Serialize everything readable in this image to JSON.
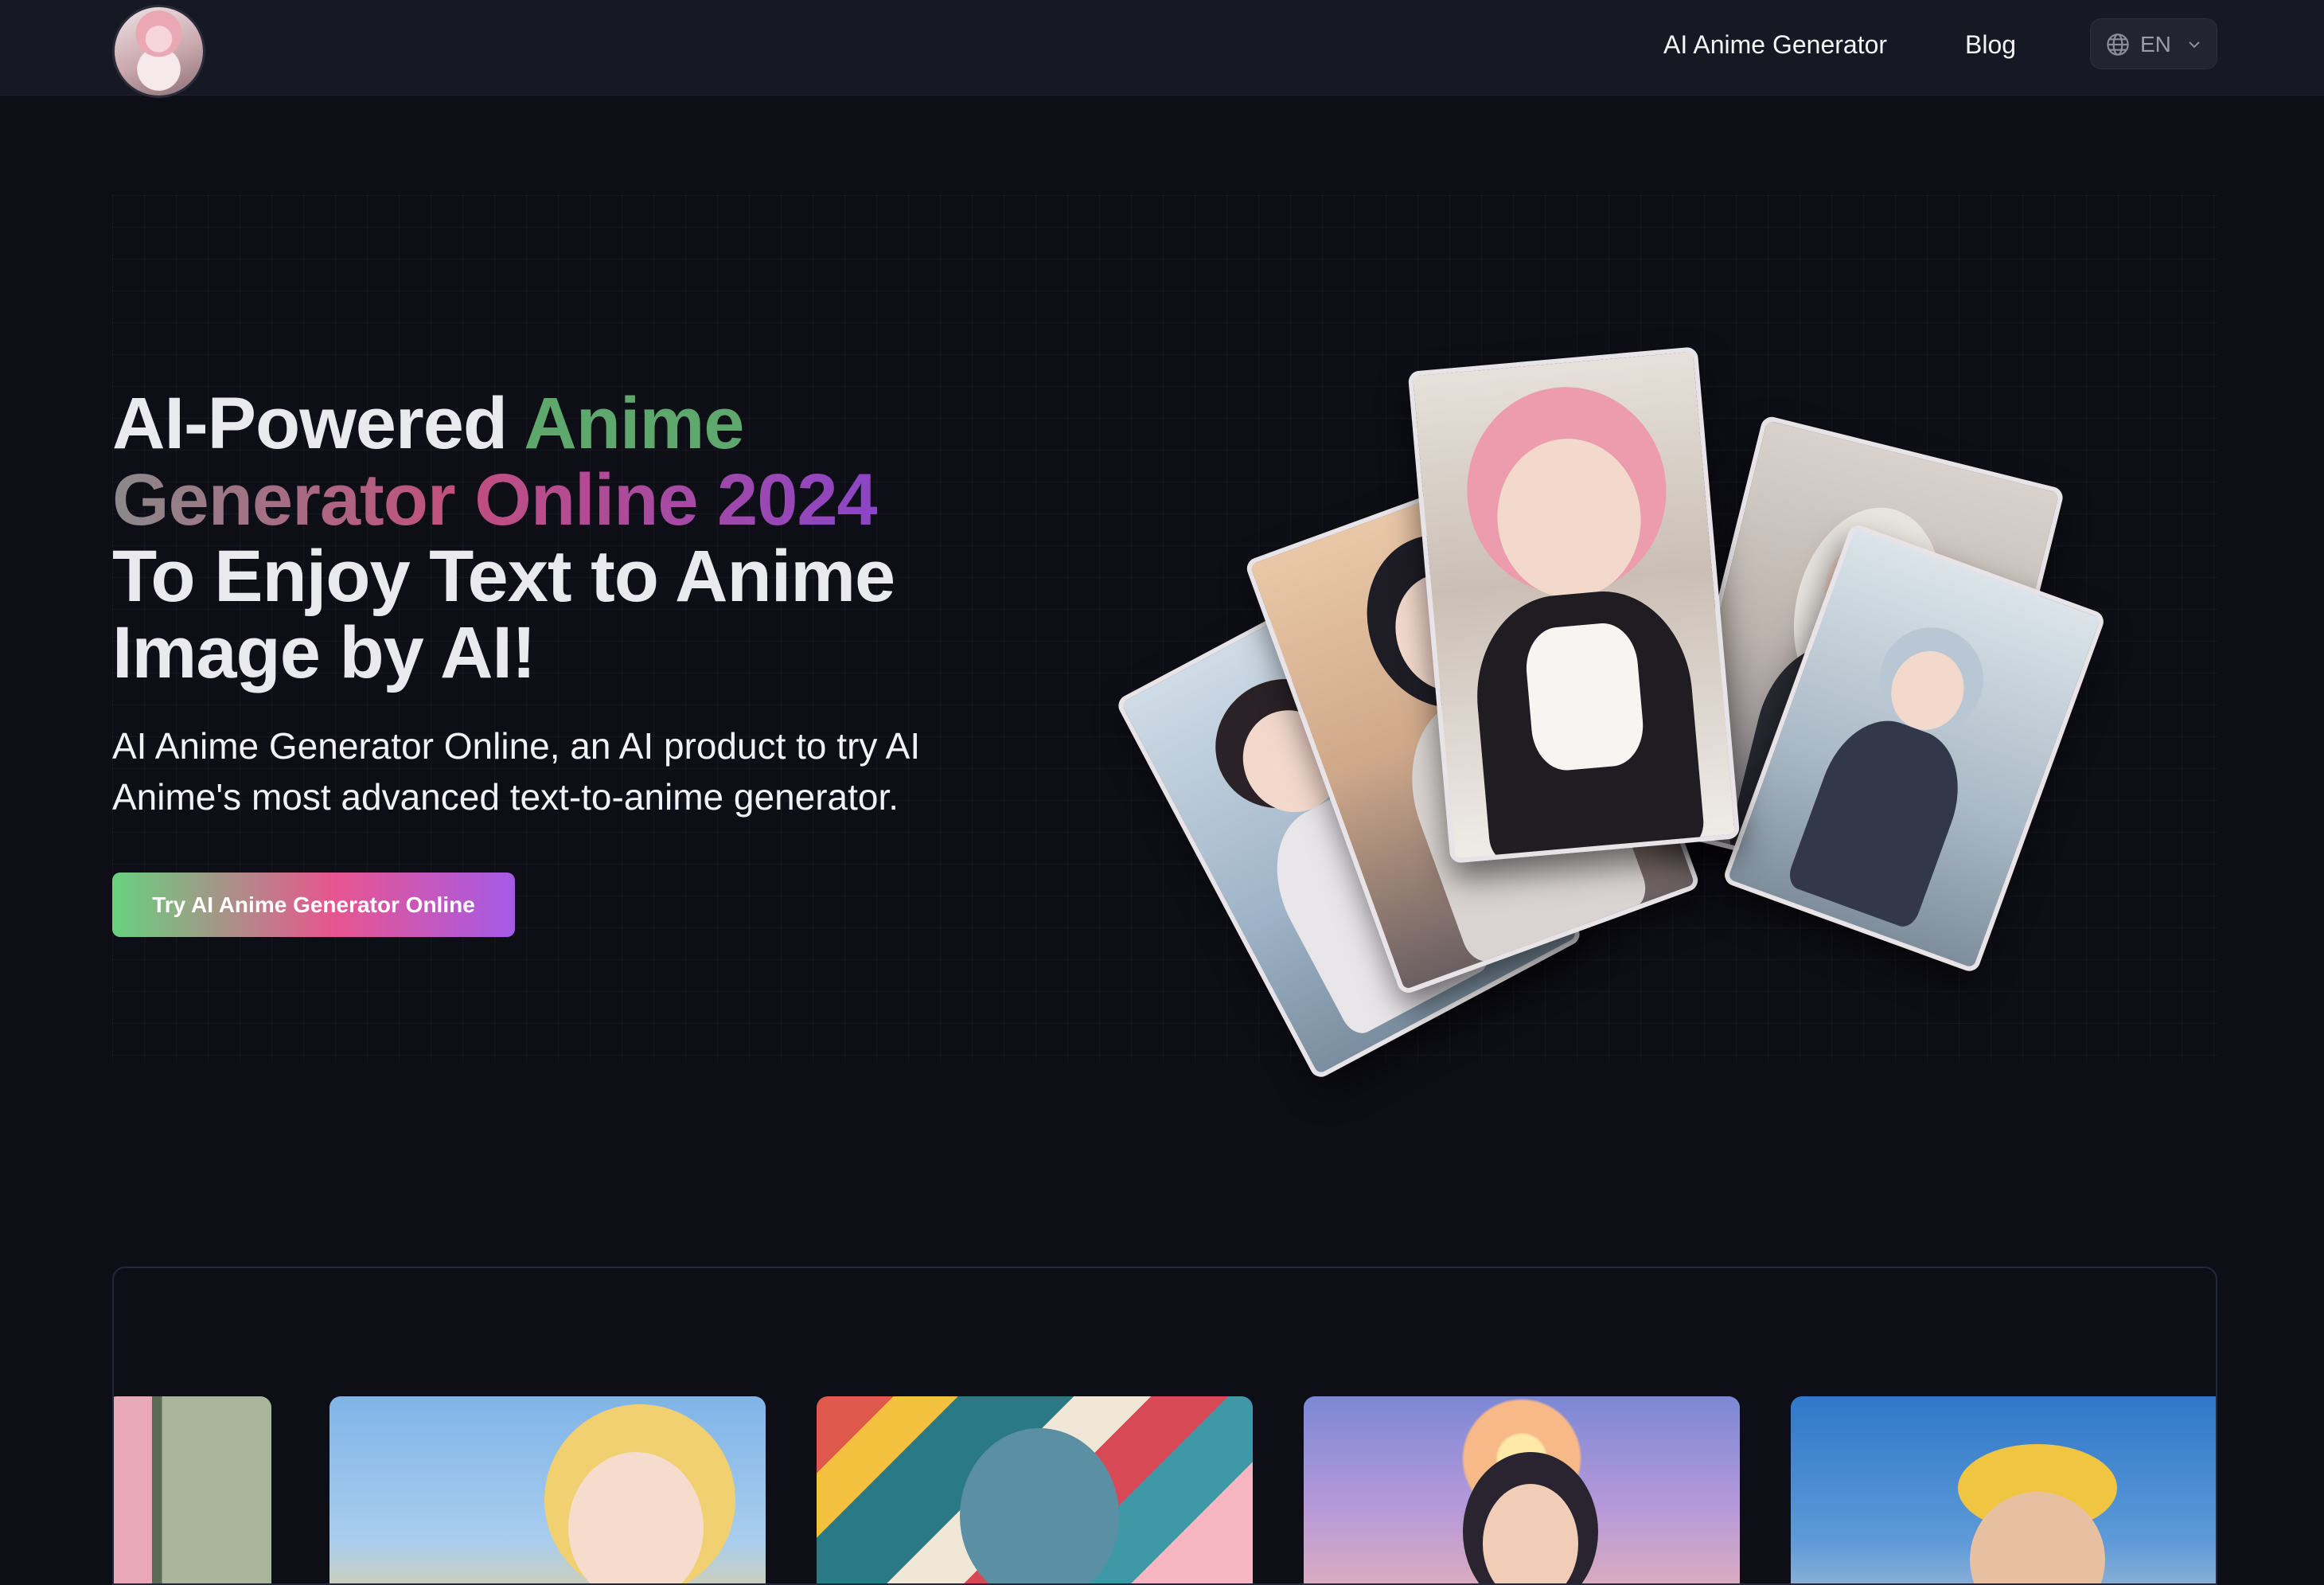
{
  "header": {
    "logo_alt": "AI Anime logo",
    "nav": [
      {
        "label": "AI Anime Generator"
      },
      {
        "label": "Blog"
      }
    ],
    "language": {
      "code": "EN"
    }
  },
  "hero": {
    "headline": {
      "part1": "AI-Powered ",
      "part2": "Anime",
      "part3": "Generator Online 2024",
      "part4": "To Enjoy Text to Anime Image by AI!"
    },
    "subtitle": "AI Anime Generator Online, an AI product to try AI Anime's most advanced text-to-anime generator.",
    "cta_label": "Try AI Anime Generator Online"
  },
  "colors": {
    "background": "#0e0e16",
    "header": "#161824",
    "accent_green": "#5fa86d",
    "accent_pink": "#c24f7d",
    "accent_purple": "#8b45c6"
  },
  "icons": {
    "language": "globe-icon",
    "dropdown": "chevron-down-icon"
  }
}
